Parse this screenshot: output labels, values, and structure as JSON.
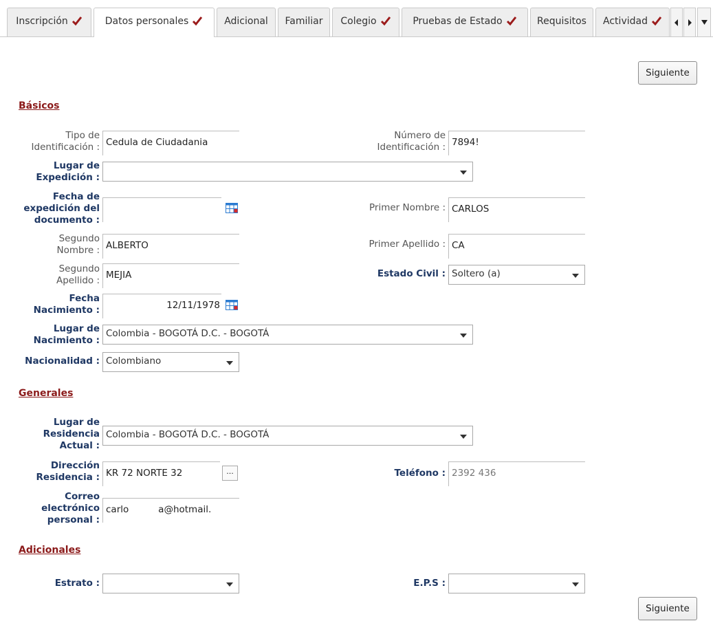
{
  "tabs": [
    {
      "label": "Inscripción",
      "checked": true
    },
    {
      "label": "Datos personales",
      "checked": true,
      "active": true
    },
    {
      "label": "Adicional",
      "checked": false
    },
    {
      "label": "Familiar",
      "checked": false
    },
    {
      "label": "Colegio",
      "checked": true
    },
    {
      "label": "Pruebas de Estado",
      "checked": true
    },
    {
      "label": "Requisitos",
      "checked": false
    },
    {
      "label": "Actividad",
      "checked": true
    }
  ],
  "colors": {
    "check": "#9b1b1b",
    "section": "#8b1a1a",
    "required_label": "#1f3864",
    "calendar": "#2b7bd1"
  },
  "buttons": {
    "next_top": "Siguiente",
    "next_bottom": "Siguiente",
    "dots": "..."
  },
  "sections": {
    "basicos": "Básicos",
    "generales": "Generales",
    "adicionales": "Adicionales"
  },
  "fields": {
    "tipo_id": {
      "label_1": "Tipo de",
      "label_2": "Identificación :",
      "value": "Cedula de Ciudadania"
    },
    "numero_id": {
      "label_1": "Número de",
      "label_2": "Identificación :",
      "value": "7894!"
    },
    "lugar_exp": {
      "label_1": "Lugar de",
      "label_2": "Expedición :",
      "value": ""
    },
    "fecha_exp": {
      "label_1": "Fecha de",
      "label_2": "expedición del",
      "label_3": "documento :",
      "value": ""
    },
    "primer_nombre": {
      "label": "Primer Nombre :",
      "value": "CARLOS"
    },
    "segundo_nombre": {
      "label_1": "Segundo",
      "label_2": "Nombre :",
      "value": "ALBERTO"
    },
    "primer_apellido": {
      "label": "Primer Apellido :",
      "value": "CA"
    },
    "segundo_apellido": {
      "label_1": "Segundo",
      "label_2": "Apellido :",
      "value": "MEJIA"
    },
    "estado_civil": {
      "label": "Estado Civil :",
      "value": "Soltero (a)"
    },
    "fecha_nac": {
      "label_1": "Fecha",
      "label_2": "Nacimiento :",
      "value": "12/11/1978"
    },
    "lugar_nac": {
      "label_1": "Lugar de",
      "label_2": "Nacimiento :",
      "value": "Colombia - BOGOTÁ D.C. - BOGOTÁ"
    },
    "nacionalidad": {
      "label": "Nacionalidad :",
      "value": "Colombiano"
    },
    "lugar_res": {
      "label_1": "Lugar de",
      "label_2": "Residencia",
      "label_3": "Actual :",
      "value": "Colombia - BOGOTÁ D.C. - BOGOTÁ"
    },
    "direccion": {
      "label_1": "Dirección",
      "label_2": "Residencia :",
      "value": "KR 72 NORTE        32"
    },
    "telefono": {
      "label": "Teléfono :",
      "value": "2392 436"
    },
    "correo": {
      "label_1": "Correo",
      "label_2": "electrónico",
      "label_3": "personal :",
      "value": "carlo          a@hotmail."
    },
    "estrato": {
      "label": "Estrato :",
      "value": ""
    },
    "eps": {
      "label": "E.P.S :",
      "value": ""
    }
  }
}
